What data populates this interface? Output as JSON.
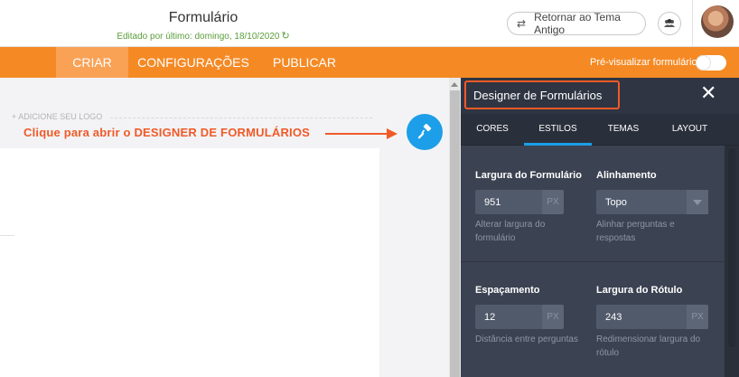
{
  "header": {
    "form_title": "Formulário",
    "edited": "Editado por último: domingo, 18/10/2020",
    "old_theme_button": "Retornar ao Tema Antigo"
  },
  "nav": {
    "tabs": [
      {
        "label": "CRIAR",
        "active": true
      },
      {
        "label": "CONFIGURAÇÕES",
        "active": false
      },
      {
        "label": "PUBLICAR",
        "active": false
      }
    ],
    "preview_label": "Pré-visualizar formulário",
    "preview_enabled": false
  },
  "canvas": {
    "logo_text": "+ ADICIONE SEU LOGO",
    "instruction": "Clique para abrir o DESIGNER DE FORMULÁRIOS"
  },
  "designer": {
    "title": "Designer de Formulários",
    "close": "✕",
    "tabs": [
      {
        "label": "CORES",
        "active": false
      },
      {
        "label": "ESTILOS",
        "active": true
      },
      {
        "label": "TEMAS",
        "active": false
      },
      {
        "label": "LAYOUT",
        "active": false
      }
    ],
    "fields": {
      "form_width": {
        "label": "Largura do Formulário",
        "value": "951",
        "unit": "PX",
        "help": "Alterar largura do formulário"
      },
      "alignment": {
        "label": "Alinhamento",
        "value": "Topo",
        "help": "Alinhar perguntas e respostas"
      },
      "spacing": {
        "label": "Espaçamento",
        "value": "12",
        "unit": "PX",
        "help": "Distância entre perguntas"
      },
      "label_width": {
        "label": "Largura do Rótulo",
        "value": "243",
        "unit": "PX",
        "help": "Redimensionar largura do rótulo"
      }
    }
  },
  "colors": {
    "orange": "#f58a25",
    "annotation": "#f05a28",
    "blue": "#1c9ee8",
    "panel": "#2f3542"
  }
}
